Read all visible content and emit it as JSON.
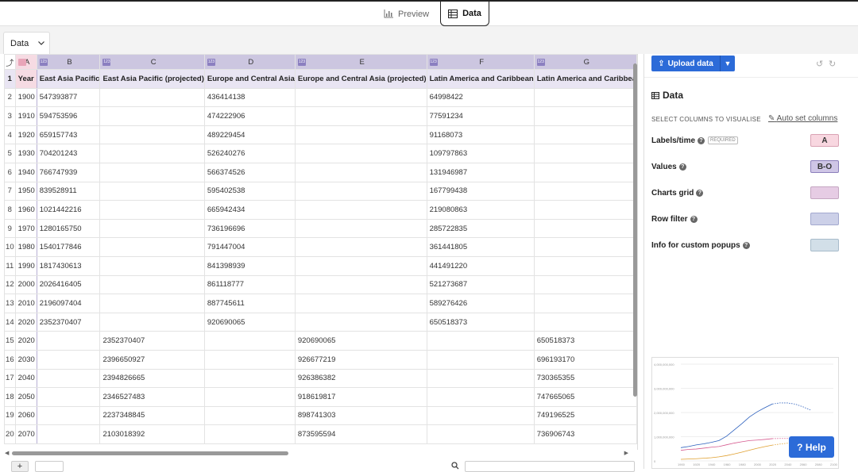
{
  "topbar": {
    "preview_label": "Preview",
    "data_label": "Data"
  },
  "sheet_tab": {
    "label": "Data"
  },
  "columns": [
    "A",
    "B",
    "C",
    "D",
    "E",
    "F",
    "G"
  ],
  "column_widths": [
    48,
    74,
    122,
    107,
    157,
    127,
    120
  ],
  "rows": [
    [
      "Year",
      "East Asia Pacific",
      "East Asia Pacific (projected)",
      "Europe and Central Asia",
      "Europe and Central Asia (projected)",
      "Latin America and Caribbean",
      "Latin America and Caribbea"
    ],
    [
      "1900",
      "547393877",
      "",
      "436414138",
      "",
      "64998422",
      ""
    ],
    [
      "1910",
      "594753596",
      "",
      "474222906",
      "",
      "77591234",
      ""
    ],
    [
      "1920",
      "659157743",
      "",
      "489229454",
      "",
      "91168073",
      ""
    ],
    [
      "1930",
      "704201243",
      "",
      "526240276",
      "",
      "109797863",
      ""
    ],
    [
      "1940",
      "766747939",
      "",
      "566374526",
      "",
      "131946987",
      ""
    ],
    [
      "1950",
      "839528911",
      "",
      "595402538",
      "",
      "167799438",
      ""
    ],
    [
      "1960",
      "1021442216",
      "",
      "665942434",
      "",
      "219080863",
      ""
    ],
    [
      "1970",
      "1280165750",
      "",
      "736196696",
      "",
      "285722835",
      ""
    ],
    [
      "1980",
      "1540177846",
      "",
      "791447004",
      "",
      "361441805",
      ""
    ],
    [
      "1990",
      "1817430613",
      "",
      "841398939",
      "",
      "441491220",
      ""
    ],
    [
      "2000",
      "2026416405",
      "",
      "861118777",
      "",
      "521273687",
      ""
    ],
    [
      "2010",
      "2196097404",
      "",
      "887745611",
      "",
      "589276426",
      ""
    ],
    [
      "2020",
      "2352370407",
      "",
      "920690065",
      "",
      "650518373",
      ""
    ],
    [
      "2020",
      "",
      "2352370407",
      "",
      "920690065",
      "",
      "650518373"
    ],
    [
      "2030",
      "",
      "2396650927",
      "",
      "926677219",
      "",
      "696193170"
    ],
    [
      "2040",
      "",
      "2394826665",
      "",
      "926386382",
      "",
      "730365355"
    ],
    [
      "2050",
      "",
      "2346527483",
      "",
      "918619817",
      "",
      "747665065"
    ],
    [
      "2060",
      "",
      "2237348845",
      "",
      "898741303",
      "",
      "749196525"
    ],
    [
      "2070",
      "",
      "2103018392",
      "",
      "873595594",
      "",
      "736906743"
    ]
  ],
  "panel": {
    "upload_label": "Upload data",
    "title": "Data",
    "select_columns_label": "SELECT COLUMNS TO VISUALISE",
    "auto_set_label": "Auto set columns",
    "bindings": [
      {
        "label": "Labels/time",
        "required": "REQUIRED",
        "value": "A",
        "color": "#f8d7e0",
        "border": "#d9a3b4"
      },
      {
        "label": "Values",
        "required": "",
        "value": "B-O",
        "color": "#cfc6e6",
        "border": "#8c80bb"
      },
      {
        "label": "Charts grid",
        "required": "",
        "value": "",
        "color": "#e6cce4",
        "border": "#c5a7c2"
      },
      {
        "label": "Row filter",
        "required": "",
        "value": "",
        "color": "#ccd0e8",
        "border": "#a3a9cf"
      },
      {
        "label": "Info for custom popups",
        "required": "",
        "value": "",
        "color": "#d2dfe8",
        "border": "#a8bccb"
      }
    ],
    "help_label": "? Help"
  },
  "thumbnail": {
    "y_ticks": [
      "4,000,000,000",
      "3,000,000,000",
      "2,000,000,000",
      "1,000,000,000",
      "0"
    ],
    "x_ticks": [
      "1900",
      "1920",
      "1940",
      "1960",
      "1980",
      "2000",
      "2020",
      "2040",
      "2060",
      "2080",
      "2100"
    ]
  },
  "colors": {
    "accent": "#2c6bd8",
    "col_header": "#ccc6e0",
    "label_col": "#f6dbe3"
  }
}
